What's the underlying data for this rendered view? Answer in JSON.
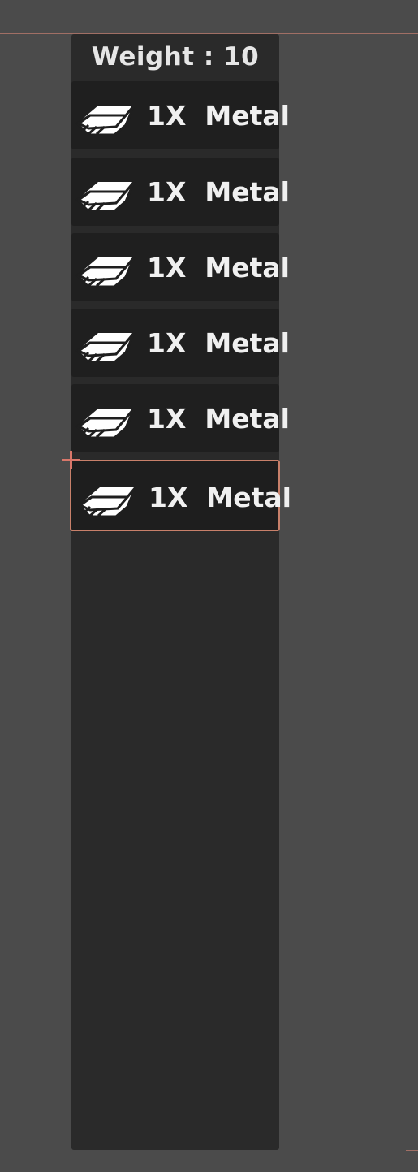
{
  "inventory": {
    "header": "Weight : 10",
    "slots": [
      {
        "label": "1X  Metal",
        "icon": "metal-bar-icon",
        "selected": false
      },
      {
        "label": "1X  Metal",
        "icon": "metal-bar-icon",
        "selected": false
      },
      {
        "label": "1X  Metal",
        "icon": "metal-bar-icon",
        "selected": false
      },
      {
        "label": "1X  Metal",
        "icon": "metal-bar-icon",
        "selected": false
      },
      {
        "label": "1X  Metal",
        "icon": "metal-bar-icon",
        "selected": false
      },
      {
        "label": "1X  Metal",
        "icon": "metal-bar-icon",
        "selected": true
      }
    ]
  },
  "colors": {
    "background": "#4b4b4b",
    "panel": "#2a2a2a",
    "slot": "#1f1f1f",
    "selection": "#c8806a",
    "text": "#f0f0f0"
  }
}
